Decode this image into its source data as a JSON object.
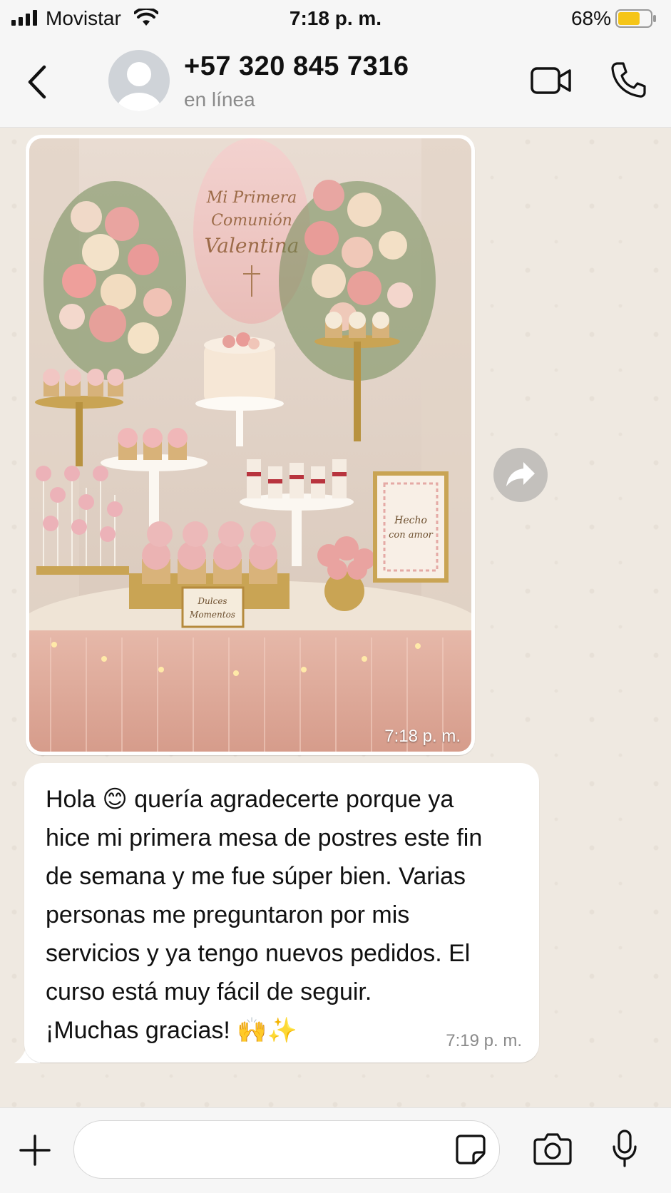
{
  "status_bar": {
    "carrier": "Movistar",
    "time": "7:18 p. m.",
    "battery_percent": "68%",
    "battery_level": 0.68,
    "icons": [
      "signal-icon",
      "wifi-icon",
      "battery-icon"
    ]
  },
  "header": {
    "contact_name": "+57 320 845 7316",
    "status": "en línea",
    "icons": [
      "back-icon",
      "avatar-icon",
      "video-call-icon",
      "phone-call-icon"
    ]
  },
  "messages": [
    {
      "type": "image",
      "image_text": {
        "sign_line1": "Mi Primera",
        "sign_line2": "Comunión",
        "sign_line3": "Valentina",
        "frame_line1": "Hecho",
        "frame_line2": "con amor",
        "plaque_line1": "Dulces",
        "plaque_line2": "Momentos"
      },
      "time": "7:18 p. m."
    },
    {
      "type": "text",
      "text": "Hola 😊 quería agradecerte porque ya\nhice mi primera mesa de postres este fin\nde semana y me fue súper bien. Varias\npersonas me preguntaron por mis\nservicios y ya tengo nuevos pedidos. El\ncurso está muy fácil de seguir.\n¡Muchas gracias! 🙌✨",
      "time": "7:19 p. m."
    }
  ],
  "composer": {
    "placeholder": "",
    "icons": [
      "plus-icon",
      "sticker-icon",
      "camera-icon",
      "microphone-icon"
    ]
  },
  "colors": {
    "chat_background": "#efe9e1",
    "bar_background": "#f6f6f6",
    "battery_fill": "#f5c518",
    "bubble": "#ffffff"
  }
}
